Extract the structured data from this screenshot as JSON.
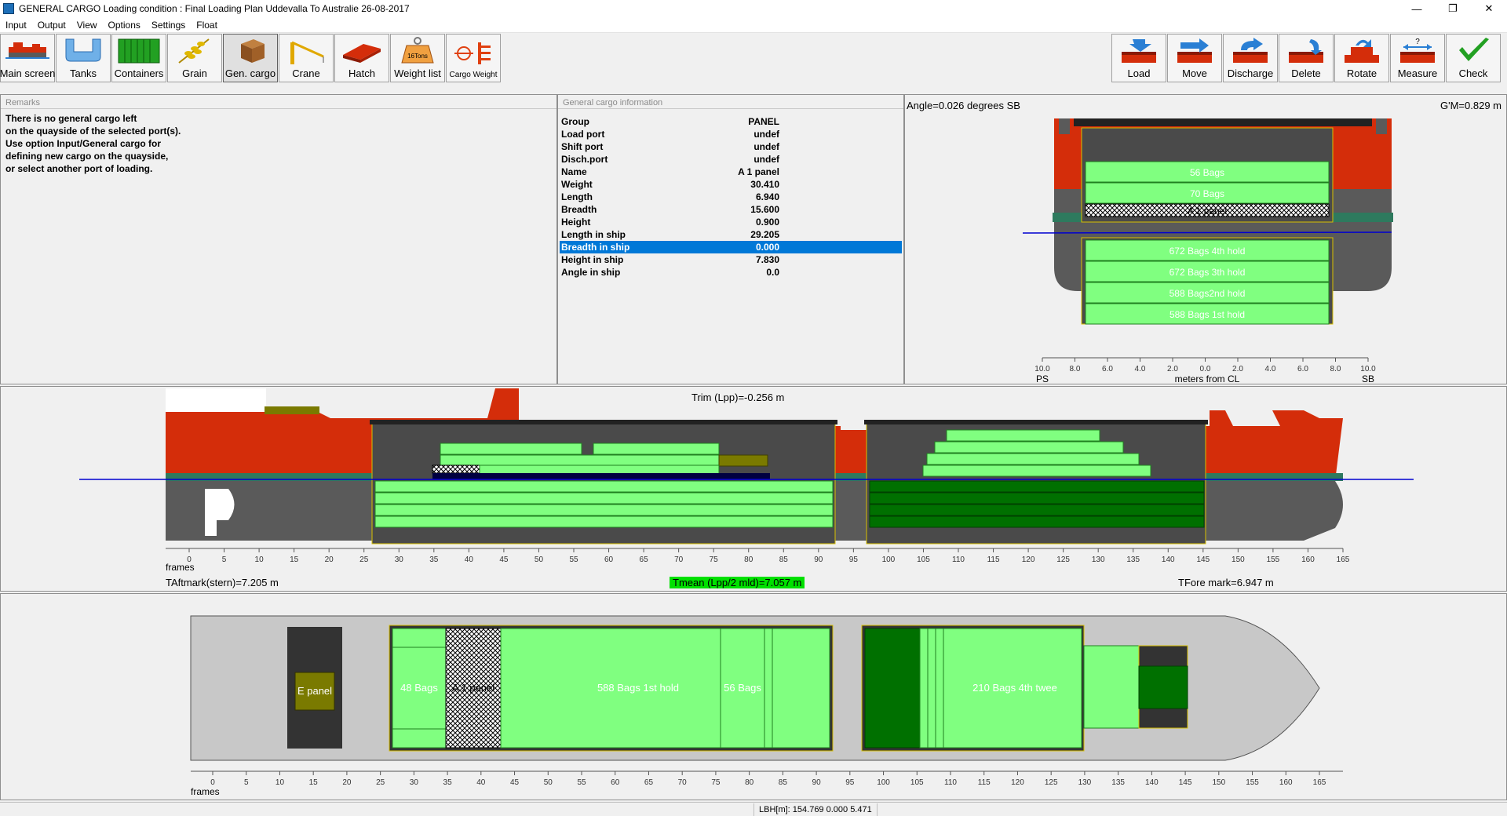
{
  "window": {
    "title": "GENERAL CARGO  Loading condition : Final Loading Plan Uddevalla To Australie 26-08-2017",
    "minimize": "—",
    "restore": "❐",
    "close": "✕"
  },
  "menu": [
    "Input",
    "Output",
    "View",
    "Options",
    "Settings",
    "Float"
  ],
  "toolbar_left": [
    {
      "label": "Main screen",
      "icon": "ship-icon"
    },
    {
      "label": "Tanks",
      "icon": "tank-icon"
    },
    {
      "label": "Containers",
      "icon": "container-icon"
    },
    {
      "label": "Grain",
      "icon": "grain-icon"
    },
    {
      "label": "Gen. cargo",
      "icon": "box-icon"
    },
    {
      "label": "Crane",
      "icon": "crane-icon"
    },
    {
      "label": "Hatch",
      "icon": "hatch-icon"
    },
    {
      "label": "Weight list",
      "icon": "weight-icon",
      "badge": "16Tons"
    },
    {
      "label": "Cargo Weight",
      "icon": "cargo-weight-icon"
    }
  ],
  "toolbar_right": [
    {
      "label": "Load",
      "icon": "load-icon"
    },
    {
      "label": "Move",
      "icon": "move-icon"
    },
    {
      "label": "Discharge",
      "icon": "discharge-icon"
    },
    {
      "label": "Delete",
      "icon": "delete-icon"
    },
    {
      "label": "Rotate",
      "icon": "rotate-icon"
    },
    {
      "label": "Measure",
      "icon": "measure-icon",
      "badge": "?"
    },
    {
      "label": "Check",
      "icon": "check-icon"
    }
  ],
  "remarks": {
    "title": "Remarks",
    "text": "There is no general cargo left\non the quayside of the selected port(s).\nUse option Input/General cargo for\ndefining new cargo on the quayside,\nor select another port of loading."
  },
  "cargo_info": {
    "title": "General cargo information",
    "rows": [
      {
        "k": "Group",
        "v": "PANEL"
      },
      {
        "k": "Load port",
        "v": "undef"
      },
      {
        "k": "Shift port",
        "v": "undef"
      },
      {
        "k": "Disch.port",
        "v": "undef"
      },
      {
        "k": "Name",
        "v": "A 1 panel"
      },
      {
        "k": "Weight",
        "v": "30.410"
      },
      {
        "k": "Length",
        "v": "6.940"
      },
      {
        "k": "Breadth",
        "v": "15.600"
      },
      {
        "k": "Height",
        "v": "0.900"
      },
      {
        "k": "Length in ship",
        "v": "29.205"
      },
      {
        "k": "Breadth in ship",
        "v": "0.000",
        "selected": true
      },
      {
        "k": "Height in ship",
        "v": "7.830"
      },
      {
        "k": "Angle in ship",
        "v": "0.0"
      }
    ]
  },
  "section": {
    "angle": "Angle=0.026 degrees SB",
    "gm": "G'M=0.829 m",
    "cargo_labels": [
      "56 Bags",
      "70 Bags",
      "A 1 panel",
      "672 Bags 4th hold",
      "672 Bags 3th hold",
      "588 Bags2nd hold",
      "588 Bags 1st hold"
    ],
    "ticks": [
      "10.0",
      "8.0",
      "6.0",
      "4.0",
      "2.0",
      "0.0",
      "2.0",
      "4.0",
      "6.0",
      "8.0",
      "10.0"
    ],
    "ps": "PS",
    "sb": "SB",
    "axis_label": "meters from CL"
  },
  "profile": {
    "trim": "Trim (Lpp)=-0.256 m",
    "frames_label": "frames",
    "frame_ticks": [
      "0",
      "5",
      "10",
      "15",
      "20",
      "25",
      "30",
      "35",
      "40",
      "45",
      "50",
      "55",
      "60",
      "65",
      "70",
      "75",
      "80",
      "85",
      "90",
      "95",
      "100",
      "105",
      "110",
      "115",
      "120",
      "125",
      "130",
      "135",
      "140",
      "145",
      "150",
      "155",
      "160",
      "165"
    ],
    "t_aft": "TAftmark(stern)=7.205 m",
    "t_mean": "Tmean (Lpp/2 mld)=7.057 m",
    "t_fore": "TFore mark=6.947 m"
  },
  "plan": {
    "labels": [
      "E panel",
      "48 Bags",
      "A 1 panel",
      "588 Bags 1st hold",
      "56 Bags",
      "210 Bags 4th twee"
    ],
    "frames_label": "frames",
    "frame_ticks": [
      "0",
      "5",
      "10",
      "15",
      "20",
      "25",
      "30",
      "35",
      "40",
      "45",
      "50",
      "55",
      "60",
      "65",
      "70",
      "75",
      "80",
      "85",
      "90",
      "95",
      "100",
      "105",
      "110",
      "115",
      "120",
      "125",
      "130",
      "135",
      "140",
      "145",
      "150",
      "155",
      "160",
      "165"
    ]
  },
  "status": {
    "text": "LBH[m]: 154.769  0.000  5.471"
  },
  "colors": {
    "cargo_green": "#80ff80",
    "dark_green": "#007000",
    "hull_red": "#d42d0a",
    "hull_gray": "#5a5a5a",
    "waterline": "#0000d0",
    "olive": "#7a7a00",
    "selection": "#0078d7"
  }
}
